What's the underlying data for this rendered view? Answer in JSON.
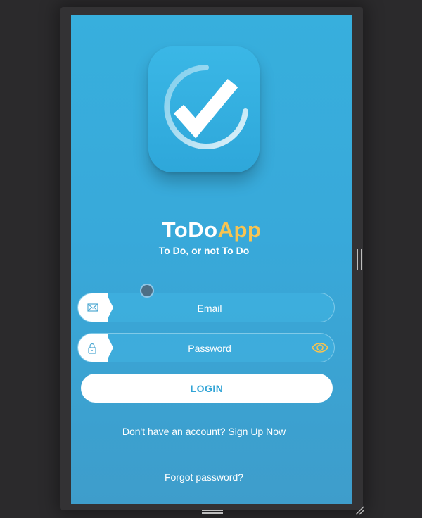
{
  "app": {
    "name_part1": "ToDo",
    "name_part2": "App",
    "tagline": "To Do, or not To Do",
    "accent_color": "#f7c451",
    "background_color": "#37afdd"
  },
  "form": {
    "email": {
      "placeholder": "Email",
      "icon": "envelope-icon"
    },
    "password": {
      "placeholder": "Password",
      "icon": "lock-icon",
      "toggle_icon": "eye-icon"
    },
    "login_label": "LOGIN"
  },
  "links": {
    "signup": "Don't have an account? Sign Up Now",
    "forgot": "Forgot password?"
  }
}
